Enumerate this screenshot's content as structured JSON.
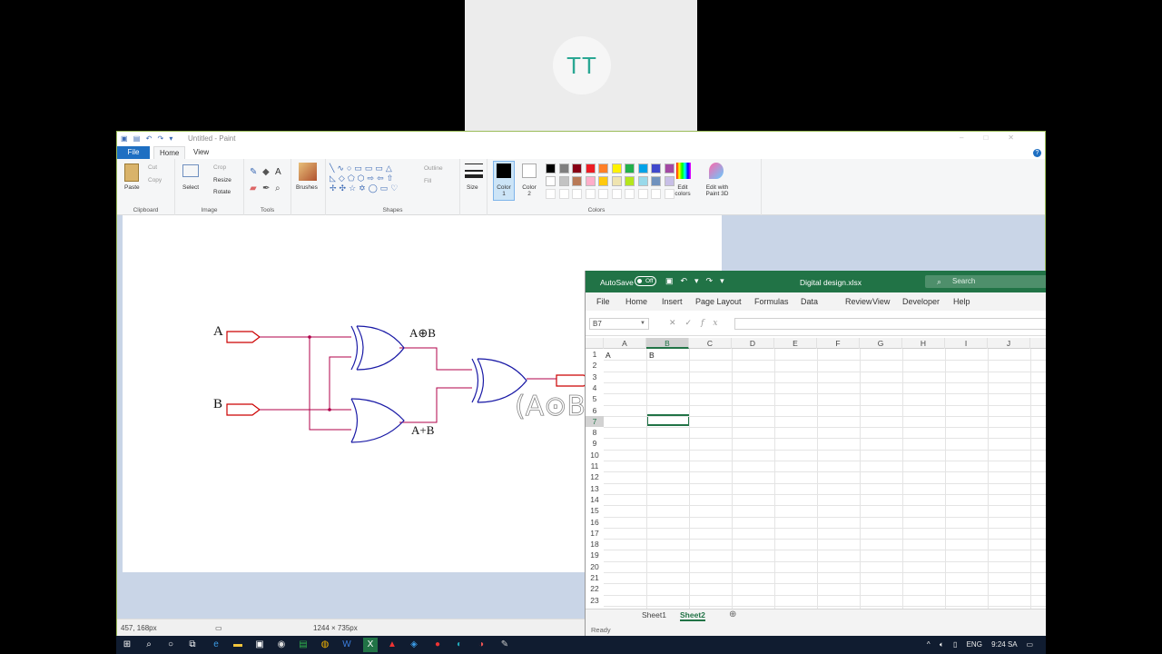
{
  "meeting": {
    "participant_initials": "TT"
  },
  "paint": {
    "window_title": "Untitled - Paint",
    "tabs": {
      "file": "File",
      "home": "Home",
      "view": "View"
    },
    "ribbon": {
      "paste": "Paste",
      "cut": "Cut",
      "copy": "Copy",
      "clipboard_group": "Clipboard",
      "select": "Select",
      "crop": "Crop",
      "resize": "Resize",
      "rotate": "Rotate",
      "image_group": "Image",
      "tools_group": "Tools",
      "brushes": "Brushes",
      "outline": "Outline",
      "fill": "Fill",
      "shapes_group": "Shapes",
      "size": "Size",
      "color1": "Color 1",
      "color2": "Color 2",
      "edit_colors": "Edit colors",
      "edit_paint3d": "Edit with Paint 3D",
      "colors_group": "Colors"
    },
    "palette": [
      "#000000",
      "#7f7f7f",
      "#880015",
      "#ed1c24",
      "#ff7f27",
      "#fff200",
      "#22b14c",
      "#00a2e8",
      "#3f48cc",
      "#a349a4",
      "#ffffff",
      "#c3c3c3",
      "#b97a57",
      "#ffaec9",
      "#ffc90e",
      "#efe4b0",
      "#b5e61d",
      "#99d9ea",
      "#7092be",
      "#c8bfe7"
    ],
    "diagram": {
      "input_a": "A",
      "input_b": "B",
      "xor_label": "A⊕B",
      "or_label": "A+B",
      "handwriting": "(A⊙B)"
    },
    "status": {
      "cursor_pos": "457, 168px",
      "canvas_size": "1244 × 735px"
    }
  },
  "excel": {
    "autosave_label": "AutoSave",
    "autosave_state": "Off",
    "file_name": "Digital design.xlsx",
    "search_placeholder": "Search",
    "menu": [
      "File",
      "Home",
      "Insert",
      "Page Layout",
      "Formulas",
      "Data",
      "Review",
      "View",
      "Developer",
      "Help"
    ],
    "name_box": "B7",
    "columns": [
      "A",
      "B",
      "C",
      "D",
      "E",
      "F",
      "G",
      "H",
      "I",
      "J"
    ],
    "rows": [
      "1",
      "2",
      "3",
      "4",
      "5",
      "6",
      "7",
      "8",
      "9",
      "10",
      "11",
      "12",
      "13",
      "14",
      "15",
      "16",
      "17",
      "18",
      "19",
      "20",
      "21",
      "22",
      "23"
    ],
    "cells": {
      "A1": "A",
      "B1": "B"
    },
    "sheets": [
      "Sheet1",
      "Sheet2"
    ],
    "active_sheet": "Sheet2",
    "status": "Ready"
  },
  "taskbar": {
    "lang": "ENG",
    "time": "9:24 SA"
  }
}
